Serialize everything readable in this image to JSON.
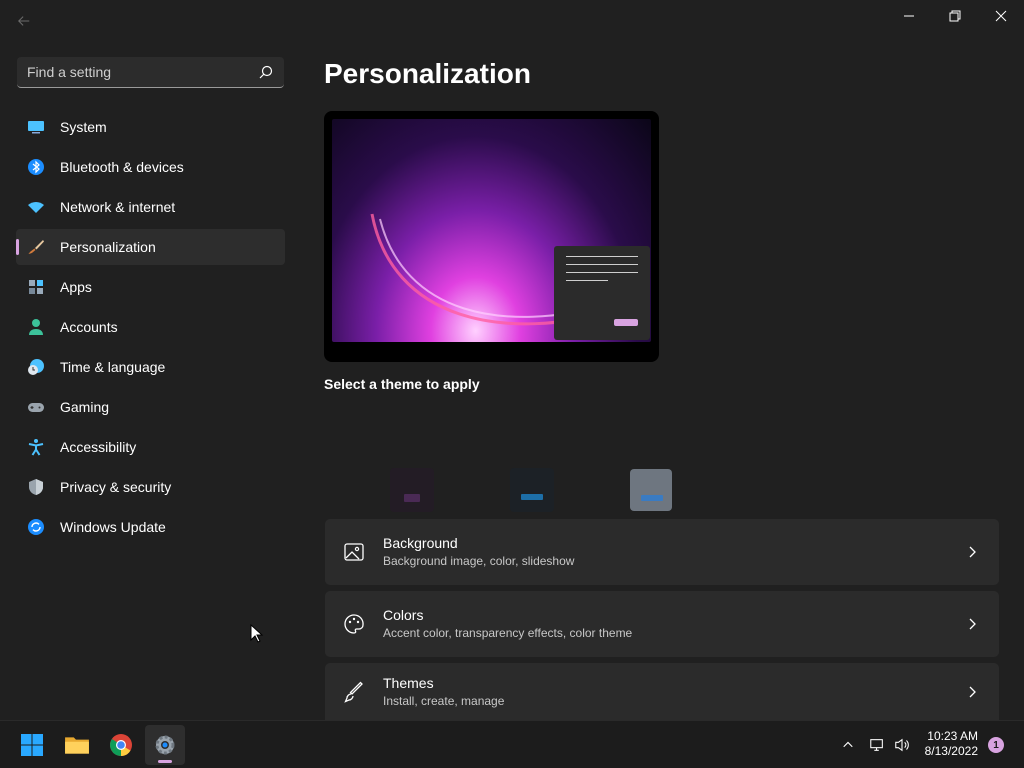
{
  "window": {
    "back_icon": "arrow-left-icon",
    "controls": [
      "minimize-icon",
      "restore-icon",
      "close-icon"
    ]
  },
  "search": {
    "placeholder": "Find a setting",
    "icon": "search-icon"
  },
  "sidebar": {
    "items": [
      {
        "label": "System",
        "icon": "monitor-icon",
        "active": false
      },
      {
        "label": "Bluetooth & devices",
        "icon": "bluetooth-icon",
        "active": false
      },
      {
        "label": "Network & internet",
        "icon": "wifi-icon",
        "active": false
      },
      {
        "label": "Personalization",
        "icon": "brush-icon",
        "active": true
      },
      {
        "label": "Apps",
        "icon": "apps-icon",
        "active": false
      },
      {
        "label": "Accounts",
        "icon": "person-icon",
        "active": false
      },
      {
        "label": "Time & language",
        "icon": "clock-globe-icon",
        "active": false
      },
      {
        "label": "Gaming",
        "icon": "gamepad-icon",
        "active": false
      },
      {
        "label": "Accessibility",
        "icon": "accessibility-icon",
        "active": false
      },
      {
        "label": "Privacy & security",
        "icon": "shield-icon",
        "active": false
      },
      {
        "label": "Windows Update",
        "icon": "update-icon",
        "active": false
      }
    ]
  },
  "main": {
    "title": "Personalization",
    "themes_label": "Select a theme to apply",
    "cards": [
      {
        "title": "Background",
        "subtitle": "Background image, color, slideshow",
        "icon": "image-icon"
      },
      {
        "title": "Colors",
        "subtitle": "Accent color, transparency effects, color theme",
        "icon": "palette-icon"
      },
      {
        "title": "Themes",
        "subtitle": "Install, create, manage",
        "icon": "brush-pen-icon"
      }
    ]
  },
  "taskbar": {
    "apps": [
      "windows-start-icon",
      "file-explorer-icon",
      "chrome-icon",
      "settings-icon"
    ],
    "active_app": "settings-icon",
    "clock": {
      "time": "10:23 AM",
      "date": "8/13/2022"
    },
    "notification_count": "1"
  },
  "colors": {
    "accent": "#d8a3e0",
    "background": "#202020",
    "card": "#2b2b2b"
  }
}
